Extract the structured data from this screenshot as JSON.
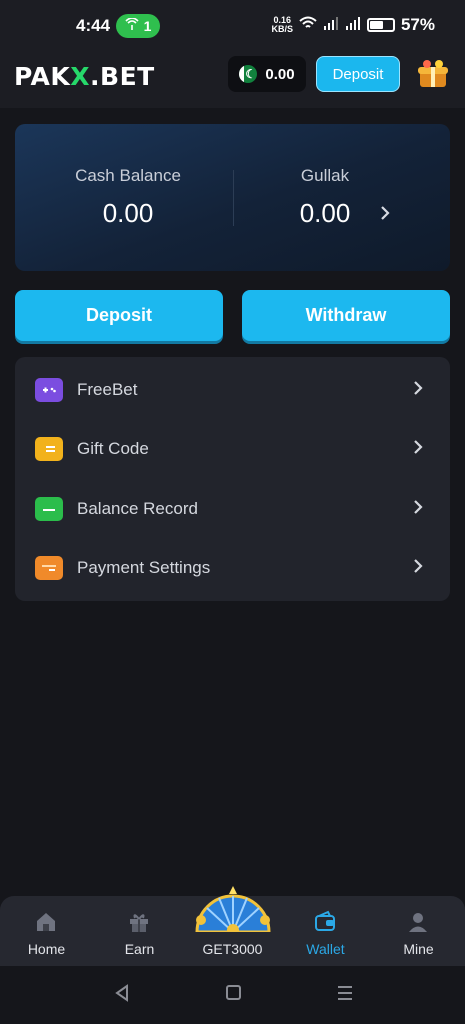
{
  "status_bar": {
    "time": "4:44",
    "hotspot_count": "1",
    "net_speed_value": "0.16",
    "net_speed_unit": "KB/S",
    "battery": "57%"
  },
  "header": {
    "logo_left": "PAK",
    "logo_x": "X",
    "logo_right": ".BET",
    "wallet_amount": "0.00",
    "deposit_label": "Deposit"
  },
  "balance": {
    "cash_label": "Cash Balance",
    "cash_value": "0.00",
    "gullak_label": "Gullak",
    "gullak_value": "0.00"
  },
  "actions": {
    "deposit": "Deposit",
    "withdraw": "Withdraw"
  },
  "menu": {
    "items": [
      {
        "label": "FreeBet",
        "icon": "gamepad-icon"
      },
      {
        "label": "Gift Code",
        "icon": "gift-code-icon"
      },
      {
        "label": "Balance Record",
        "icon": "balance-record-icon"
      },
      {
        "label": "Payment Settings",
        "icon": "payment-card-icon"
      }
    ]
  },
  "tabs": [
    {
      "label": "Home",
      "icon": "home-icon"
    },
    {
      "label": "Earn",
      "icon": "gift-icon"
    },
    {
      "label": "GET3000",
      "icon": "prize-wheel-icon"
    },
    {
      "label": "Wallet",
      "icon": "wallet-icon",
      "active": true
    },
    {
      "label": "Mine",
      "icon": "user-icon"
    }
  ],
  "colors": {
    "accent": "#1cb8ef",
    "brand_green": "#26d86a",
    "active_tab": "#2ba8e6",
    "background": "#15161b"
  }
}
